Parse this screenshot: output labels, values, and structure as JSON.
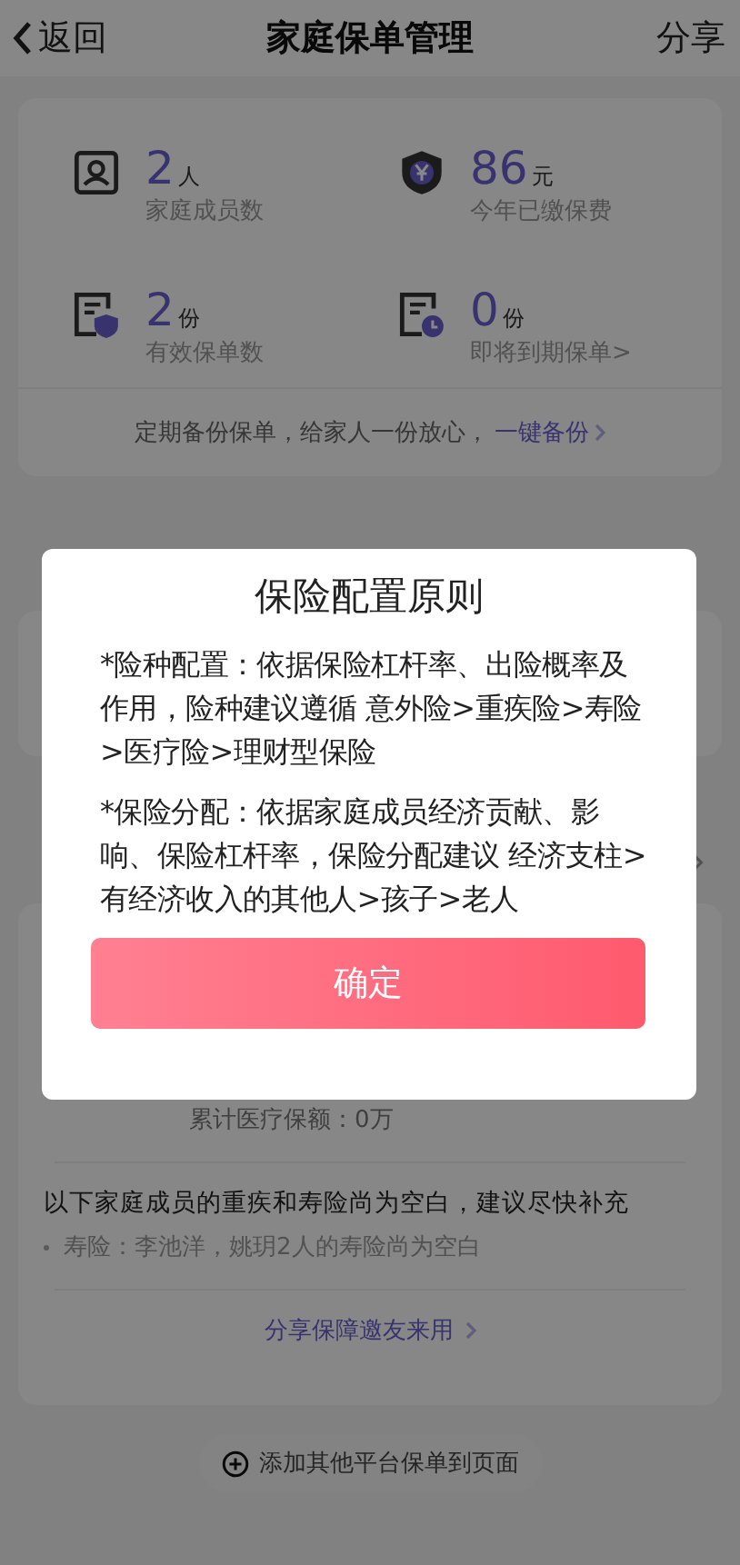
{
  "header": {
    "back_label": "返回",
    "title": "家庭保单管理",
    "action": "分享"
  },
  "stats": [
    {
      "kind": "person",
      "value": "2",
      "unit": "人",
      "label": "家庭成员数"
    },
    {
      "kind": "shield-yen",
      "value": "86",
      "unit": "元",
      "label": "今年已缴保费"
    },
    {
      "kind": "doc-shield",
      "value": "2",
      "unit": "份",
      "label": "有效保单数"
    },
    {
      "kind": "doc-clock",
      "value": "0",
      "unit": "份",
      "label": "即将到期保单>"
    }
  ],
  "backup": {
    "text": "定期备份保单，给家人一份放心，",
    "link": "一键备份"
  },
  "coverage_card": {
    "medical_total": "累计医疗保额：0万",
    "warning": "以下家庭成员的重疾和寿险尚为空白，建议尽快补充",
    "warning_item": "寿险：李池洋，姚玥2人的寿险尚为空白",
    "share_link": "分享保障邀友来用"
  },
  "add_button": "添加其他平台保单到页面",
  "dialog": {
    "title": "保险配置原则",
    "paragraphs": [
      "*险种配置：依据保险杠杆率、出险概率及作用，险种建议遵循 意外险>重疾险>寿险>医疗险>理财型保险",
      "*保险分配：依据家庭成员经济贡献、影响、保险杠杆率，保险分配建议 经济支柱>有经济收入的其他人>孩子>老人"
    ],
    "confirm": "确定"
  }
}
